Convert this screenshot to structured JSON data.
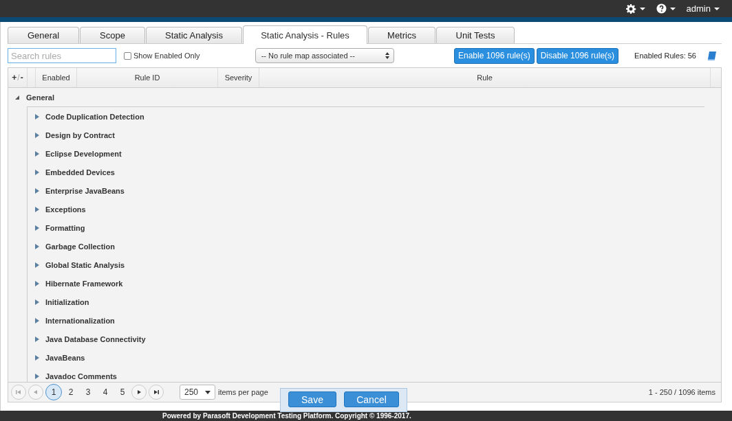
{
  "header": {
    "user": "admin"
  },
  "tabs": [
    {
      "label": "General",
      "selected": false
    },
    {
      "label": "Scope",
      "selected": false
    },
    {
      "label": "Static Analysis",
      "selected": false
    },
    {
      "label": "Static Analysis - Rules",
      "selected": true
    },
    {
      "label": "Metrics",
      "selected": false
    },
    {
      "label": "Unit Tests",
      "selected": false
    }
  ],
  "toolbar": {
    "search": {
      "placeholder": "Search rules"
    },
    "show_enabled_only": {
      "label": "Show Enabled Only",
      "checked": false
    },
    "rule_map": "-- No rule map associated --",
    "enable_button": "Enable 1096 rule(s)",
    "disable_button": "Disable 1096 rule(s)",
    "enabled_rules": "Enabled Rules: 56"
  },
  "table": {
    "expand_collapse": [
      "+",
      "/",
      "-"
    ],
    "columns": [
      "Enabled",
      "Rule ID",
      "Severity",
      "Rule"
    ],
    "tree": [
      {
        "label": "General",
        "expanded": true,
        "children": [
          {
            "label": "Code Duplication Detection",
            "expanded": false
          },
          {
            "label": "Design by Contract",
            "expanded": false
          },
          {
            "label": "Eclipse Development",
            "expanded": false
          },
          {
            "label": "Embedded Devices",
            "expanded": false
          },
          {
            "label": "Enterprise JavaBeans",
            "expanded": false
          },
          {
            "label": "Exceptions",
            "expanded": false
          },
          {
            "label": "Formatting",
            "expanded": false
          },
          {
            "label": "Garbage Collection",
            "expanded": false
          },
          {
            "label": "Global Static Analysis",
            "expanded": false
          },
          {
            "label": "Hibernate Framework",
            "expanded": false
          },
          {
            "label": "Initialization",
            "expanded": false
          },
          {
            "label": "Internationalization",
            "expanded": false
          },
          {
            "label": "Java Database Connectivity",
            "expanded": false
          },
          {
            "label": "JavaBeans",
            "expanded": false
          },
          {
            "label": "Javadoc Comments",
            "expanded": false
          }
        ]
      }
    ]
  },
  "pager": {
    "pages": [
      {
        "label": "1",
        "selected": true
      },
      {
        "label": "2",
        "selected": false
      },
      {
        "label": "3",
        "selected": false
      },
      {
        "label": "4",
        "selected": false
      },
      {
        "label": "5",
        "selected": false
      }
    ],
    "page_size": "250",
    "page_size_label": "items per page",
    "range": "1 - 250 / 1096 items"
  },
  "actions": [
    "Save",
    "Cancel"
  ],
  "footer": "Powered by Parasoft Development Testing Platform. Copyright © 1996-2017."
}
